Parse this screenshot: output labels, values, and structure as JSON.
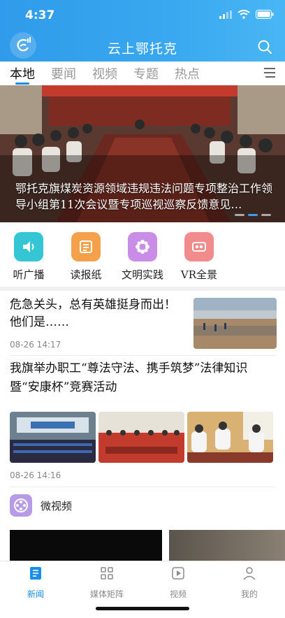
{
  "status": {
    "time": "4:37"
  },
  "header": {
    "title": "云上鄂托克"
  },
  "tabs": [
    {
      "label": "本地"
    },
    {
      "label": "要闻"
    },
    {
      "label": "视频"
    },
    {
      "label": "专题"
    },
    {
      "label": "热点"
    }
  ],
  "banner": {
    "caption": "鄂托克旗煤炭资源领域违规违法问题专项整治工作领导小组第11次会议暨专项巡视巡察反馈意见…"
  },
  "quick_entries": [
    {
      "label": "听广播",
      "icon": "speaker-icon",
      "color": "#35c6d6"
    },
    {
      "label": "读报纸",
      "icon": "newspaper-icon",
      "color": "#f5a04a"
    },
    {
      "label": "文明实践",
      "icon": "flower-icon",
      "color": "#c98de8"
    },
    {
      "label": "VR全景",
      "icon": "vr-goggles-icon",
      "color": "#f28b8b"
    }
  ],
  "news": [
    {
      "title": "危急关头，总有英雄挺身而出！他们是……",
      "time": "08-26  14:17"
    },
    {
      "title": "我旗举办职工“尊法守法、携手筑梦”法律知识暨“安康杯”竞赛活动",
      "time": "08-26  14:16"
    }
  ],
  "micro_video": {
    "label": "微视频"
  },
  "bottom_nav": [
    {
      "label": "新闻",
      "icon": "news-icon",
      "active": true
    },
    {
      "label": "媒体矩阵",
      "icon": "grid-icon",
      "active": false
    },
    {
      "label": "视频",
      "icon": "play-icon",
      "active": false
    },
    {
      "label": "我的",
      "icon": "person-icon",
      "active": false
    }
  ],
  "colors": {
    "accent": "#1a8ee8",
    "header_blue": "#3aa8f0"
  }
}
